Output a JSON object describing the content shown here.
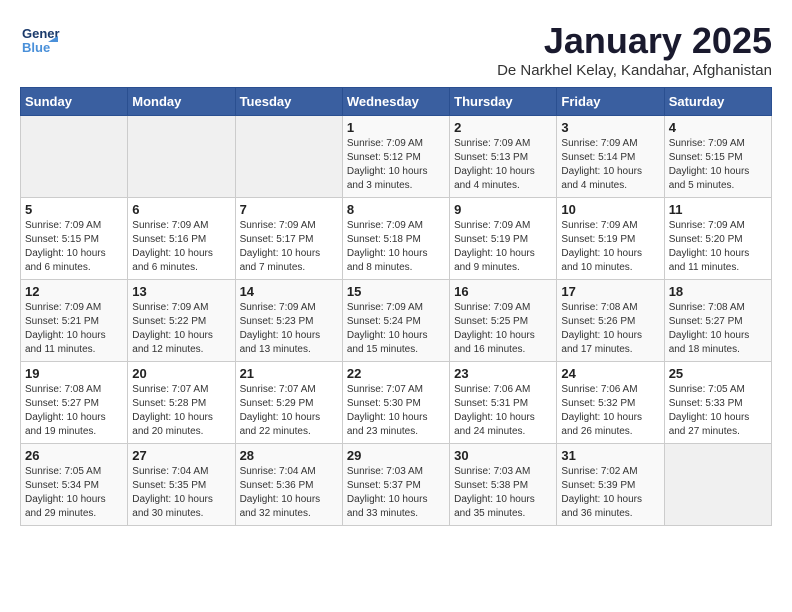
{
  "logo": {
    "line1": "General",
    "line2": "Blue"
  },
  "title": "January 2025",
  "subtitle": "De Narkhel Kelay, Kandahar, Afghanistan",
  "days_of_week": [
    "Sunday",
    "Monday",
    "Tuesday",
    "Wednesday",
    "Thursday",
    "Friday",
    "Saturday"
  ],
  "weeks": [
    [
      {
        "day": "",
        "info": ""
      },
      {
        "day": "",
        "info": ""
      },
      {
        "day": "",
        "info": ""
      },
      {
        "day": "1",
        "sunrise": "7:09 AM",
        "sunset": "5:12 PM",
        "daylight": "10 hours and 3 minutes."
      },
      {
        "day": "2",
        "sunrise": "7:09 AM",
        "sunset": "5:13 PM",
        "daylight": "10 hours and 4 minutes."
      },
      {
        "day": "3",
        "sunrise": "7:09 AM",
        "sunset": "5:14 PM",
        "daylight": "10 hours and 4 minutes."
      },
      {
        "day": "4",
        "sunrise": "7:09 AM",
        "sunset": "5:15 PM",
        "daylight": "10 hours and 5 minutes."
      }
    ],
    [
      {
        "day": "5",
        "sunrise": "7:09 AM",
        "sunset": "5:15 PM",
        "daylight": "10 hours and 6 minutes."
      },
      {
        "day": "6",
        "sunrise": "7:09 AM",
        "sunset": "5:16 PM",
        "daylight": "10 hours and 6 minutes."
      },
      {
        "day": "7",
        "sunrise": "7:09 AM",
        "sunset": "5:17 PM",
        "daylight": "10 hours and 7 minutes."
      },
      {
        "day": "8",
        "sunrise": "7:09 AM",
        "sunset": "5:18 PM",
        "daylight": "10 hours and 8 minutes."
      },
      {
        "day": "9",
        "sunrise": "7:09 AM",
        "sunset": "5:19 PM",
        "daylight": "10 hours and 9 minutes."
      },
      {
        "day": "10",
        "sunrise": "7:09 AM",
        "sunset": "5:19 PM",
        "daylight": "10 hours and 10 minutes."
      },
      {
        "day": "11",
        "sunrise": "7:09 AM",
        "sunset": "5:20 PM",
        "daylight": "10 hours and 11 minutes."
      }
    ],
    [
      {
        "day": "12",
        "sunrise": "7:09 AM",
        "sunset": "5:21 PM",
        "daylight": "10 hours and 11 minutes."
      },
      {
        "day": "13",
        "sunrise": "7:09 AM",
        "sunset": "5:22 PM",
        "daylight": "10 hours and 12 minutes."
      },
      {
        "day": "14",
        "sunrise": "7:09 AM",
        "sunset": "5:23 PM",
        "daylight": "10 hours and 13 minutes."
      },
      {
        "day": "15",
        "sunrise": "7:09 AM",
        "sunset": "5:24 PM",
        "daylight": "10 hours and 15 minutes."
      },
      {
        "day": "16",
        "sunrise": "7:09 AM",
        "sunset": "5:25 PM",
        "daylight": "10 hours and 16 minutes."
      },
      {
        "day": "17",
        "sunrise": "7:08 AM",
        "sunset": "5:26 PM",
        "daylight": "10 hours and 17 minutes."
      },
      {
        "day": "18",
        "sunrise": "7:08 AM",
        "sunset": "5:27 PM",
        "daylight": "10 hours and 18 minutes."
      }
    ],
    [
      {
        "day": "19",
        "sunrise": "7:08 AM",
        "sunset": "5:27 PM",
        "daylight": "10 hours and 19 minutes."
      },
      {
        "day": "20",
        "sunrise": "7:07 AM",
        "sunset": "5:28 PM",
        "daylight": "10 hours and 20 minutes."
      },
      {
        "day": "21",
        "sunrise": "7:07 AM",
        "sunset": "5:29 PM",
        "daylight": "10 hours and 22 minutes."
      },
      {
        "day": "22",
        "sunrise": "7:07 AM",
        "sunset": "5:30 PM",
        "daylight": "10 hours and 23 minutes."
      },
      {
        "day": "23",
        "sunrise": "7:06 AM",
        "sunset": "5:31 PM",
        "daylight": "10 hours and 24 minutes."
      },
      {
        "day": "24",
        "sunrise": "7:06 AM",
        "sunset": "5:32 PM",
        "daylight": "10 hours and 26 minutes."
      },
      {
        "day": "25",
        "sunrise": "7:05 AM",
        "sunset": "5:33 PM",
        "daylight": "10 hours and 27 minutes."
      }
    ],
    [
      {
        "day": "26",
        "sunrise": "7:05 AM",
        "sunset": "5:34 PM",
        "daylight": "10 hours and 29 minutes."
      },
      {
        "day": "27",
        "sunrise": "7:04 AM",
        "sunset": "5:35 PM",
        "daylight": "10 hours and 30 minutes."
      },
      {
        "day": "28",
        "sunrise": "7:04 AM",
        "sunset": "5:36 PM",
        "daylight": "10 hours and 32 minutes."
      },
      {
        "day": "29",
        "sunrise": "7:03 AM",
        "sunset": "5:37 PM",
        "daylight": "10 hours and 33 minutes."
      },
      {
        "day": "30",
        "sunrise": "7:03 AM",
        "sunset": "5:38 PM",
        "daylight": "10 hours and 35 minutes."
      },
      {
        "day": "31",
        "sunrise": "7:02 AM",
        "sunset": "5:39 PM",
        "daylight": "10 hours and 36 minutes."
      },
      {
        "day": "",
        "info": ""
      }
    ]
  ],
  "labels": {
    "sunrise": "Sunrise:",
    "sunset": "Sunset:",
    "daylight": "Daylight hours"
  }
}
